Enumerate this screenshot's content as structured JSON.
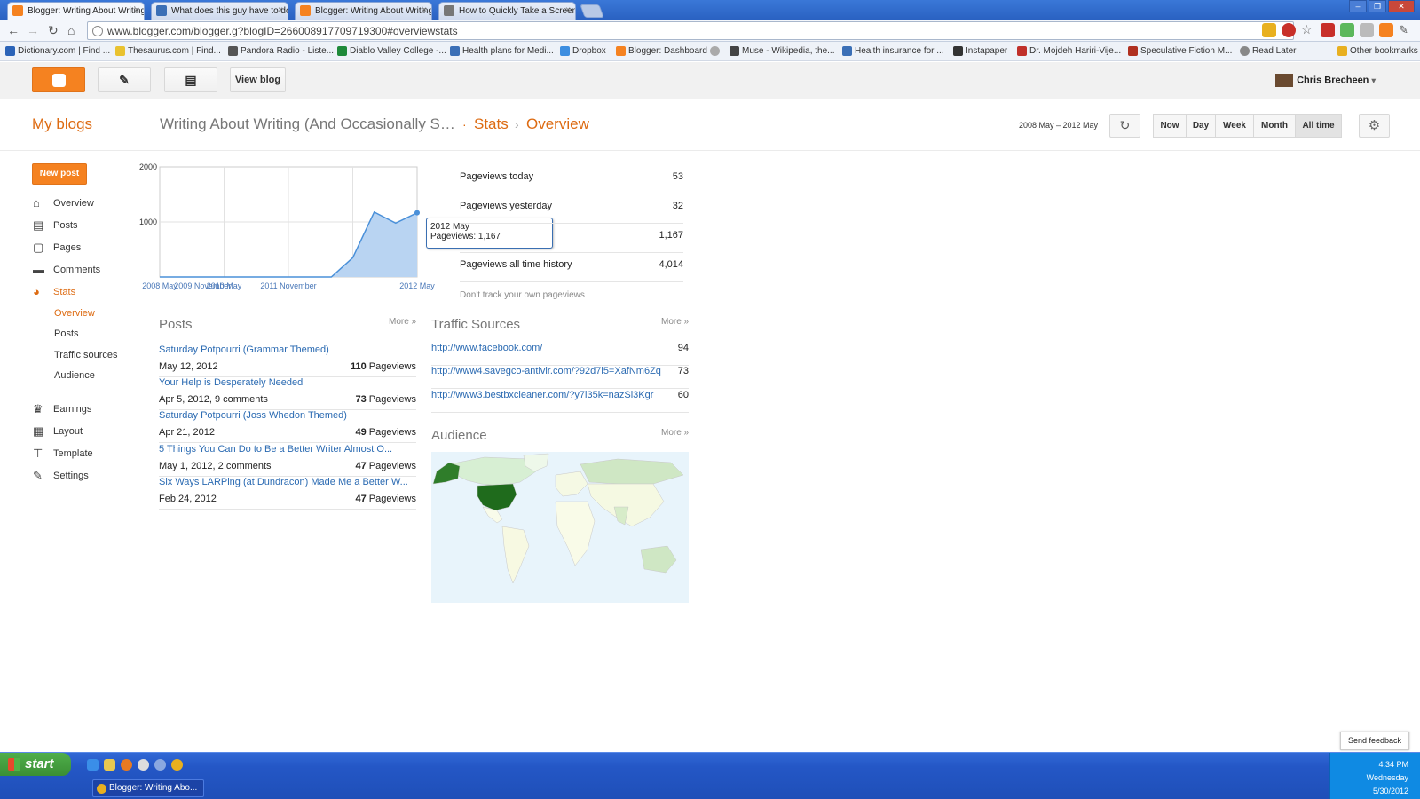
{
  "browser": {
    "tabs": [
      {
        "label": "Blogger: Writing About Writing",
        "color": "#f58220"
      },
      {
        "label": "What does this guy have to do",
        "color": "#3b6fb6"
      },
      {
        "label": "Blogger: Writing About Writing",
        "color": "#f58220"
      },
      {
        "label": "How to Quickly Take a Screens",
        "color": "#777777"
      }
    ],
    "url": "www.blogger.com/blogger.g?blogID=266008917709719300#overviewstats",
    "bookmarks": [
      {
        "label": "Dictionary.com | Find ...",
        "color": "#2a63b8"
      },
      {
        "label": "Thesaurus.com | Find...",
        "color": "#e9c230"
      },
      {
        "label": "Pandora Radio - Liste...",
        "color": "#555555"
      },
      {
        "label": "Diablo Valley College -...",
        "color": "#1f8a3a"
      },
      {
        "label": "Health plans for Medi...",
        "color": "#3b6fb6"
      },
      {
        "label": "Dropbox",
        "color": "#3d8ee0"
      },
      {
        "label": "Blogger: Dashboard",
        "color": "#f58220"
      },
      {
        "label": "",
        "color": "#aaaaaa"
      },
      {
        "label": "Muse - Wikipedia, the...",
        "color": "#444444"
      },
      {
        "label": "Health insurance for ...",
        "color": "#3b6fb6"
      },
      {
        "label": "Instapaper",
        "color": "#333333"
      },
      {
        "label": "Dr. Mojdeh Hariri-Vije...",
        "color": "#c0302a"
      },
      {
        "label": "Speculative Fiction M...",
        "color": "#b03020"
      },
      {
        "label": "Read Later",
        "color": "#888888"
      },
      {
        "label": "Other bookmarks",
        "color": "#e8b020"
      }
    ]
  },
  "toolbar": {
    "view_blog": "View blog",
    "user": "Chris Brecheen",
    "user_caret": "▾"
  },
  "header": {
    "my_blogs": "My blogs",
    "blog_name": "Writing About Writing (And Occasionally S…",
    "dot": "·",
    "crumb_stats": "Stats",
    "crumb_sep": "›",
    "crumb_overview": "Overview",
    "date_range": "2008 May – 2012 May",
    "ranges": [
      "Now",
      "Day",
      "Week",
      "Month",
      "All time"
    ],
    "selected_range": "All time"
  },
  "sidebar": {
    "new_post": "New post",
    "items": [
      {
        "label": "Overview",
        "icon": "home-icon",
        "glyph": "⌂"
      },
      {
        "label": "Posts",
        "icon": "posts-icon",
        "glyph": "▤"
      },
      {
        "label": "Pages",
        "icon": "pages-icon",
        "glyph": "▢"
      },
      {
        "label": "Comments",
        "icon": "comments-icon",
        "glyph": "▬"
      },
      {
        "label": "Stats",
        "icon": "stats-icon",
        "glyph": "◕"
      }
    ],
    "stats_sub": [
      "Overview",
      "Posts",
      "Traffic sources",
      "Audience"
    ],
    "items2": [
      {
        "label": "Earnings",
        "icon": "trophy-icon",
        "glyph": "♛"
      },
      {
        "label": "Layout",
        "icon": "layout-icon",
        "glyph": "▦"
      },
      {
        "label": "Template",
        "icon": "template-icon",
        "glyph": "⊤"
      },
      {
        "label": "Settings",
        "icon": "wrench-icon",
        "glyph": "✎"
      }
    ]
  },
  "chart_data": {
    "type": "area",
    "x": [
      "2008 May",
      "2009 May",
      "2009 November",
      "2010 May",
      "2010 November",
      "2011 May",
      "2011 November",
      "2011 December",
      "2012 January",
      "2012 February",
      "2012 March",
      "2012 April",
      "2012 May"
    ],
    "values": [
      0,
      0,
      0,
      0,
      0,
      0,
      0,
      0,
      0,
      350,
      1180,
      980,
      1167
    ],
    "xticks": [
      "2008 May",
      "2009 November",
      "2010 May",
      "2011 November",
      "2012 May"
    ],
    "yticks": [
      "2000",
      "1000"
    ],
    "ylim": [
      0,
      2000
    ],
    "color": "#4a90d9",
    "fill": "#b9d4f2",
    "tooltip": {
      "label": "2012 May",
      "value_text": "Pageviews: 1,167"
    }
  },
  "pageviews": [
    {
      "label": "Pageviews today",
      "value": "53"
    },
    {
      "label": "Pageviews yesterday",
      "value": "32"
    },
    {
      "label": "",
      "value": "1,167"
    },
    {
      "label": "Pageviews all time history",
      "value": "4,014"
    }
  ],
  "dont_track": "Don't track your own pageviews",
  "posts_section": {
    "title": "Posts",
    "more": "More »",
    "items": [
      {
        "title": "Saturday Potpourri (Grammar Themed)",
        "date": "May 12, 2012",
        "count": "110",
        "unit": "Pageviews"
      },
      {
        "title": "Your Help is Desperately Needed",
        "date": "Apr 5, 2012, 9 comments",
        "count": "73",
        "unit": "Pageviews"
      },
      {
        "title": "Saturday Potpourri (Joss Whedon Themed)",
        "date": "Apr 21, 2012",
        "count": "49",
        "unit": "Pageviews"
      },
      {
        "title": "5 Things You Can Do to Be a Better Writer Almost O...",
        "date": "May 1, 2012, 2 comments",
        "count": "47",
        "unit": "Pageviews"
      },
      {
        "title": "Six Ways LARPing (at Dundracon) Made Me a Better W...",
        "date": "Feb 24, 2012",
        "count": "47",
        "unit": "Pageviews"
      }
    ]
  },
  "traffic_section": {
    "title": "Traffic Sources",
    "more": "More »",
    "items": [
      {
        "url": "http://www.facebook.com/",
        "count": "94"
      },
      {
        "url": "http://www4.savegco-antivir.com/?92d7i5=XafNm6Zq",
        "count": "73"
      },
      {
        "url": "http://www3.bestbxcleaner.com/?y7i35k=nazSl3Kgr",
        "count": "60"
      }
    ]
  },
  "audience_section": {
    "title": "Audience",
    "more": "More »"
  },
  "feedback": "Send feedback",
  "taskbar": {
    "start": "start",
    "task": "Blogger: Writing Abo...",
    "time": "4:34 PM",
    "day": "Wednesday",
    "date": "5/30/2012"
  }
}
